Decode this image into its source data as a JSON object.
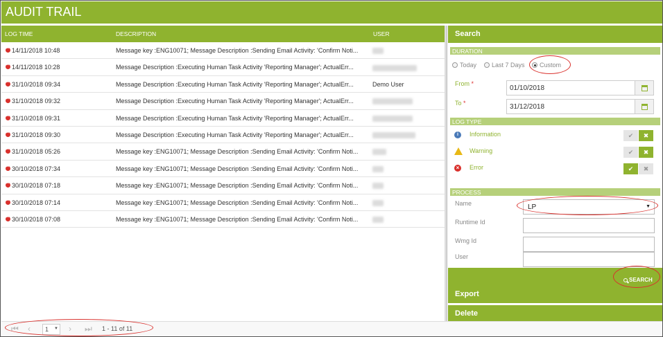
{
  "header": {
    "title": "AUDIT TRAIL"
  },
  "grid": {
    "columns": {
      "log_time": "LOG TIME",
      "description": "DESCRIPTION",
      "user": "USER"
    },
    "rows": [
      {
        "time": "14/11/2018 10:48",
        "description": "Message key :ENG10071; Message Description :Sending Email Activity: 'Confirm Noti...",
        "user": ""
      },
      {
        "time": "14/11/2018 10:28",
        "description": "Message Description :Executing Human Task Activity 'Reporting Manager'; ActualErr...",
        "user": ""
      },
      {
        "time": "31/10/2018 09:34",
        "description": "Message Description :Executing Human Task Activity 'Reporting Manager'; ActualErr...",
        "user": "Demo User"
      },
      {
        "time": "31/10/2018 09:32",
        "description": "Message Description :Executing Human Task Activity 'Reporting Manager'; ActualErr...",
        "user": ""
      },
      {
        "time": "31/10/2018 09:31",
        "description": "Message Description :Executing Human Task Activity 'Reporting Manager'; ActualErr...",
        "user": ""
      },
      {
        "time": "31/10/2018 09:30",
        "description": "Message Description :Executing Human Task Activity 'Reporting Manager'; ActualErr...",
        "user": ""
      },
      {
        "time": "31/10/2018 05:26",
        "description": "Message key :ENG10071; Message Description :Sending Email Activity: 'Confirm Noti...",
        "user": ""
      },
      {
        "time": "30/10/2018 07:34",
        "description": "Message key :ENG10071; Message Description :Sending Email Activity: 'Confirm Noti...",
        "user": ""
      },
      {
        "time": "30/10/2018 07:18",
        "description": "Message key :ENG10071; Message Description :Sending Email Activity: 'Confirm Noti...",
        "user": ""
      },
      {
        "time": "30/10/2018 07:14",
        "description": "Message key :ENG10071; Message Description :Sending Email Activity: 'Confirm Noti...",
        "user": ""
      },
      {
        "time": "30/10/2018 07:08",
        "description": "Message key :ENG10071; Message Description :Sending Email Activity: 'Confirm Noti...",
        "user": ""
      }
    ]
  },
  "search": {
    "title": "Search",
    "duration": {
      "label": "DURATION",
      "options": [
        "Today",
        "Last 7 Days",
        "Custom"
      ],
      "selected": "Custom",
      "from_label": "From",
      "to_label": "To",
      "required_mark": "*",
      "from_value": "01/10/2018",
      "to_value": "31/12/2018"
    },
    "log_type": {
      "label": "LOG TYPE",
      "items": [
        {
          "label": "Information",
          "icon": "info-icon",
          "enabled": false
        },
        {
          "label": "Warning",
          "icon": "warning-icon",
          "enabled": false
        },
        {
          "label": "Error",
          "icon": "error-icon",
          "enabled": true
        }
      ],
      "check_glyph": "✔",
      "cross_glyph": "✖"
    },
    "process": {
      "label": "PROCESS",
      "name_label": "Name",
      "name_value": "LP",
      "runtime_id_label": "Runtime Id",
      "wmg_id_label": "Wmg Id",
      "user_label": "User"
    },
    "search_button": "SEARCH"
  },
  "export_label": "Export",
  "delete_label": "Delete",
  "pager": {
    "page": "1",
    "summary": "1 - 11 of 11"
  },
  "colors": {
    "brand": "#8fb32f",
    "brand_light": "#b6d07a",
    "error": "#d9302c",
    "highlight": "#d9302c"
  }
}
